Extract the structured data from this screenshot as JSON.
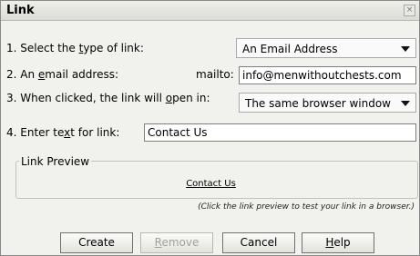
{
  "dialog": {
    "title": "Link",
    "close_glyph": "×"
  },
  "row1": {
    "label_pre": "1. Select the ",
    "label_acc": "t",
    "label_post": "ype of link:",
    "select_value": "An Email Address"
  },
  "row2": {
    "label_pre": "2. An ",
    "label_acc": "e",
    "label_post": "mail address:",
    "prefix": "mailto:",
    "input_value": "info@menwithoutchests.com"
  },
  "row3": {
    "label_pre": "3. When clicked, the link will ",
    "label_acc": "o",
    "label_post": "pen in:",
    "select_value": "The same browser window"
  },
  "row4": {
    "label_pre": "4. Enter te",
    "label_acc": "x",
    "label_post": "t for link:",
    "input_value": "Contact Us"
  },
  "preview": {
    "legend": "Link Preview",
    "link_text": "Contact Us",
    "hint": "(Click the link preview to test your link in a browser.)"
  },
  "buttons": {
    "create": "Create",
    "remove_acc": "R",
    "remove_rest": "emove",
    "cancel": "Cancel",
    "help_acc": "H",
    "help_rest": "elp"
  }
}
